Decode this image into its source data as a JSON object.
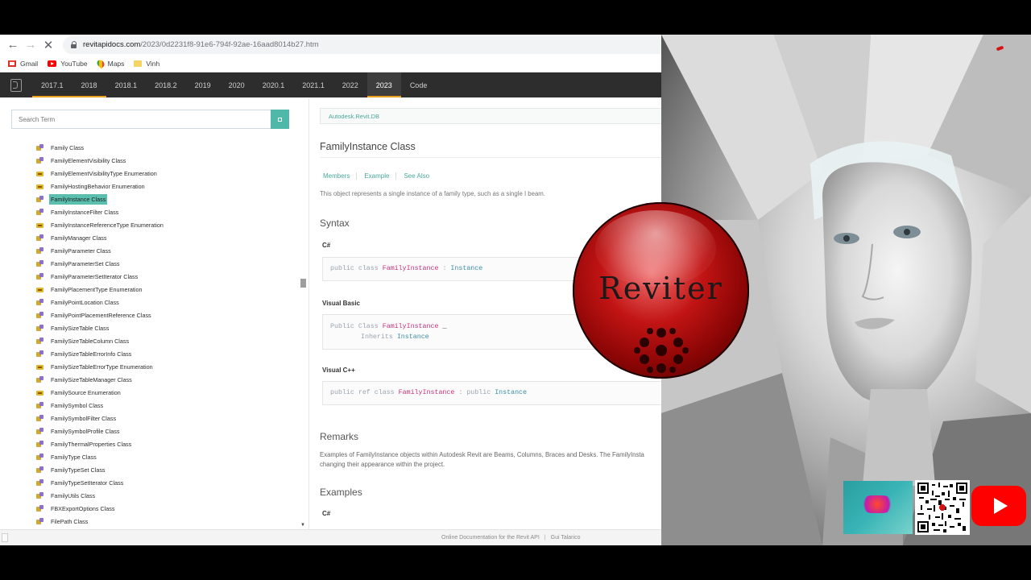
{
  "browser": {
    "url_host": "revitapidocs.com",
    "url_path": "/2023/0d2231f8-91e6-794f-92ae-16aad8014b27.htm",
    "bookmarks": [
      {
        "label": "Gmail",
        "icon": "gmail-icon"
      },
      {
        "label": "YouTube",
        "icon": "youtube-icon"
      },
      {
        "label": "Maps",
        "icon": "maps-icon"
      },
      {
        "label": "Vinh",
        "icon": "folder-icon"
      }
    ]
  },
  "header": {
    "versions": [
      "2017.1",
      "2018",
      "2018.1",
      "2018.2",
      "2019",
      "2020",
      "2020.1",
      "2021.1",
      "2022",
      "2023"
    ],
    "active_version": "2023",
    "code_label": "Code",
    "accent_color": "#f0a020"
  },
  "search": {
    "placeholder": "Search Term"
  },
  "tree": {
    "items": [
      {
        "label": "Family Class",
        "kind": "class"
      },
      {
        "label": "FamilyElementVisibility Class",
        "kind": "class"
      },
      {
        "label": "FamilyElementVisibilityType Enumeration",
        "kind": "enum"
      },
      {
        "label": "FamilyHostingBehavior Enumeration",
        "kind": "enum"
      },
      {
        "label": "FamilyInstance Class",
        "kind": "class",
        "selected": true
      },
      {
        "label": "FamilyInstanceFilter Class",
        "kind": "class"
      },
      {
        "label": "FamilyInstanceReferenceType Enumeration",
        "kind": "enum"
      },
      {
        "label": "FamilyManager Class",
        "kind": "class"
      },
      {
        "label": "FamilyParameter Class",
        "kind": "class"
      },
      {
        "label": "FamilyParameterSet Class",
        "kind": "class"
      },
      {
        "label": "FamilyParameterSetIterator Class",
        "kind": "class"
      },
      {
        "label": "FamilyPlacementType Enumeration",
        "kind": "enum"
      },
      {
        "label": "FamilyPointLocation Class",
        "kind": "class"
      },
      {
        "label": "FamilyPointPlacementReference Class",
        "kind": "class"
      },
      {
        "label": "FamilySizeTable Class",
        "kind": "class"
      },
      {
        "label": "FamilySizeTableColumn Class",
        "kind": "class"
      },
      {
        "label": "FamilySizeTableErrorInfo Class",
        "kind": "class"
      },
      {
        "label": "FamilySizeTableErrorType Enumeration",
        "kind": "enum"
      },
      {
        "label": "FamilySizeTableManager Class",
        "kind": "class"
      },
      {
        "label": "FamilySource Enumeration",
        "kind": "enum"
      },
      {
        "label": "FamilySymbol Class",
        "kind": "class"
      },
      {
        "label": "FamilySymbolFilter Class",
        "kind": "class"
      },
      {
        "label": "FamilySymbolProfile Class",
        "kind": "class"
      },
      {
        "label": "FamilyThermalProperties Class",
        "kind": "class"
      },
      {
        "label": "FamilyType Class",
        "kind": "class"
      },
      {
        "label": "FamilyTypeSet Class",
        "kind": "class"
      },
      {
        "label": "FamilyTypeSetIterator Class",
        "kind": "class"
      },
      {
        "label": "FamilyUtils Class",
        "kind": "class"
      },
      {
        "label": "FBXExportOptions Class",
        "kind": "class"
      },
      {
        "label": "FilePath Class",
        "kind": "class"
      }
    ],
    "selected_color": "#5bbfb0"
  },
  "doc": {
    "breadcrumb": "Autodesk.Revit.DB",
    "title": "FamilyInstance Class",
    "tabs": [
      "Members",
      "Example",
      "See Also"
    ],
    "summary": "This object represents a single instance of a family type, such as a single I beam.",
    "syntax_heading": "Syntax",
    "csharp": {
      "lang": "C#",
      "kw1": "public class",
      "type": "FamilyInstance",
      "sep": ":",
      "base": "Instance"
    },
    "vb": {
      "lang": "Visual Basic",
      "kw1": "Public Class",
      "type": "FamilyInstance",
      "cont": "_",
      "kw2": "Inherits",
      "base": "Instance"
    },
    "cpp": {
      "lang": "Visual C++",
      "kw1": "public ref class",
      "type": "FamilyInstance",
      "sep": ": public",
      "base": "Instance"
    },
    "remarks_heading": "Remarks",
    "remarks_line1": "Examples of FamilyInstance objects within Autodesk Revit are Beams, Columns, Braces and Desks. The FamilyInsta",
    "remarks_line2": "changing their appearance within the project.",
    "examples_heading": "Examples",
    "examples_lang": "C#"
  },
  "footer": {
    "doc_label": "Online Documentation for the Revit API",
    "separator": "|",
    "author": "Gui Talarico"
  },
  "overlay": {
    "logo_text": "Reviter",
    "logo_color": "#c21414"
  }
}
